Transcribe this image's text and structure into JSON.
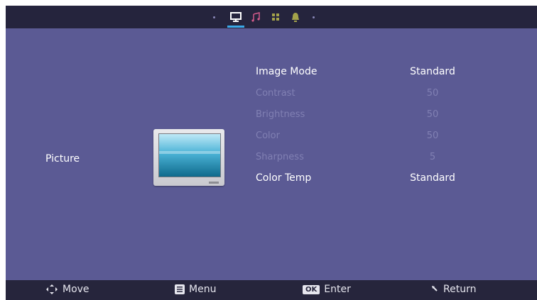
{
  "tabs": [
    {
      "id": "dot-left",
      "icon": "dot-icon"
    },
    {
      "id": "picture",
      "icon": "monitor-icon",
      "active": true
    },
    {
      "id": "sound",
      "icon": "music-note-icon"
    },
    {
      "id": "channel",
      "icon": "grid-icon"
    },
    {
      "id": "notify",
      "icon": "bell-icon"
    },
    {
      "id": "dot-right",
      "icon": "dot-icon"
    }
  ],
  "section": {
    "label": "Picture"
  },
  "settings": [
    {
      "name": "Image Mode",
      "value": "Standard",
      "enabled": true
    },
    {
      "name": "Contrast",
      "value": "50",
      "enabled": false
    },
    {
      "name": "Brightness",
      "value": "50",
      "enabled": false
    },
    {
      "name": "Color",
      "value": "50",
      "enabled": false
    },
    {
      "name": "Sharpness",
      "value": "5",
      "enabled": false
    },
    {
      "name": "Color Temp",
      "value": "Standard",
      "enabled": true
    }
  ],
  "footer": {
    "move": "Move",
    "menu": "Menu",
    "ok_key": "OK",
    "enter": "Enter",
    "return": "Return"
  },
  "colors": {
    "background": "#5b5a94",
    "bar": "#25243d",
    "accent": "#3aa9e8"
  }
}
